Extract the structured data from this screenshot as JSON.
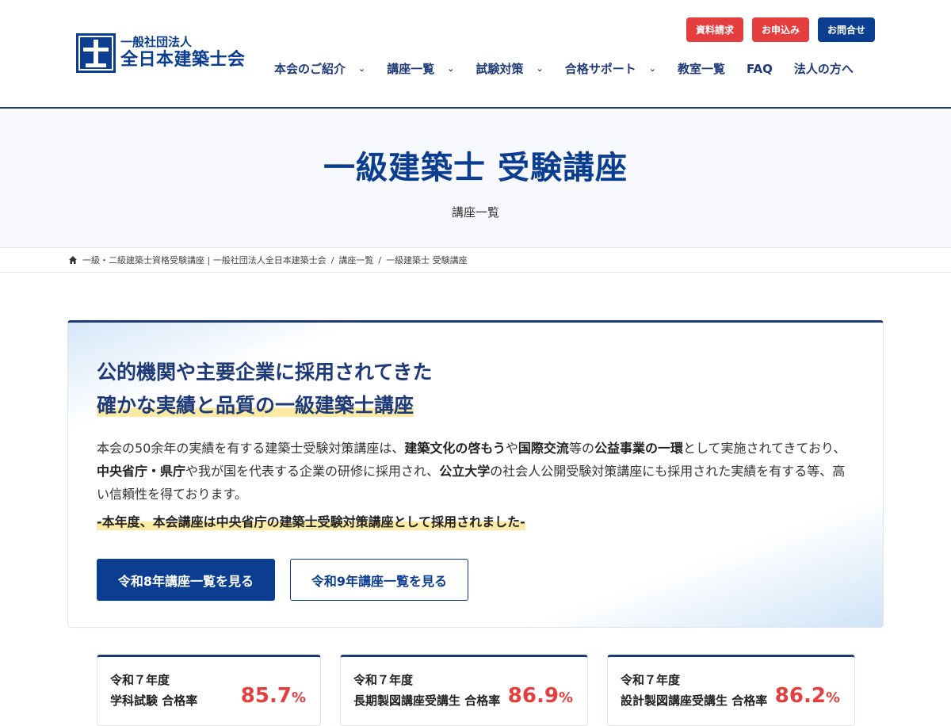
{
  "header": {
    "logo_sub": "一般社団法人",
    "logo_main": "全日本建築士会",
    "top_buttons": [
      "資料請求",
      "お申込み",
      "お問合せ"
    ],
    "nav": [
      "本会のご紹介",
      "講座一覧",
      "試験対策",
      "合格サポート",
      "教室一覧",
      "FAQ",
      "法人の方へ"
    ]
  },
  "hero": {
    "title": "一級建築士 受験講座",
    "subtitle": "講座一覧"
  },
  "breadcrumb": [
    "一級・二級建築士資格受験講座 | 一般社団法人全日本建築士会",
    "講座一覧",
    "一級建築士 受験講座"
  ],
  "intro": {
    "heading_line1": "公的機関や主要企業に採用されてきた",
    "heading_line2": "確かな実績と品質の一級建築士講座",
    "body": [
      {
        "t": "本会の50余年の実績を有する建築士受験対策講座は、",
        "b": false
      },
      {
        "t": "建築文化の啓もう",
        "b": true
      },
      {
        "t": "や",
        "b": false
      },
      {
        "t": "国際交流",
        "b": true
      },
      {
        "t": "等の",
        "b": false
      },
      {
        "t": "公益事業の一環",
        "b": true
      },
      {
        "t": "として実施されてきており、",
        "b": false
      },
      {
        "t": "中央省庁・県庁",
        "b": true
      },
      {
        "t": "や我が国を代表する企業の研修に採用され、",
        "b": false
      },
      {
        "t": "公立大学",
        "b": true
      },
      {
        "t": "の社会人公開受験対策講座にも採用された実績を有する等、高い信頼性を得ております。",
        "b": false
      }
    ],
    "note": "-本年度、本会講座は中央省庁の建築士受験対策講座として採用されました-",
    "btn_primary": "令和8年講座一覧を見る",
    "btn_outline": "令和9年講座一覧を見る"
  },
  "stats": [
    {
      "year": "令和７年度",
      "label": "学科試験 合格率",
      "value": "85.7",
      "unit": "%"
    },
    {
      "year": "令和７年度",
      "label": "長期製図講座受講生 合格率",
      "value": "86.9",
      "unit": "%"
    },
    {
      "year": "令和７年度",
      "label": "設計製図講座受講生 合格率",
      "value": "86.2",
      "unit": "%"
    }
  ],
  "colors": {
    "navy": "#0b3d91",
    "red": "#e53e3e",
    "highlight": "#fbeaa3"
  }
}
